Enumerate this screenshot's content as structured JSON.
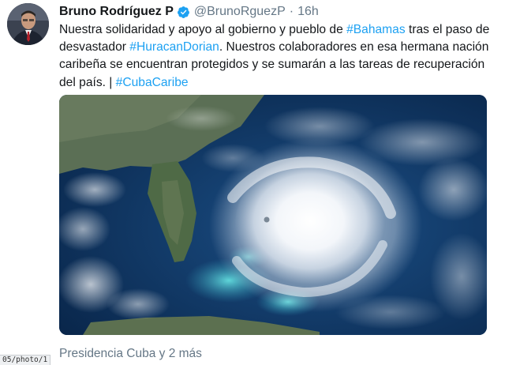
{
  "tweet": {
    "author_name": "Bruno Rodríguez P",
    "handle": "@BrunoRguezP",
    "separator": "·",
    "time": "16h",
    "text_segments": [
      {
        "text": "Nuestra solidaridad  y apoyo al gobierno y pueblo de ",
        "hashtag": false
      },
      {
        "text": "#Bahamas",
        "hashtag": true
      },
      {
        "text": " tras el paso de desvastador ",
        "hashtag": false
      },
      {
        "text": "#HuracanDorian",
        "hashtag": true
      },
      {
        "text": ". Nuestros colaboradores en esa hermana nación caribeña se encuentran protegidos y se sumarán a las tareas de recuperación del país. | ",
        "hashtag": false
      },
      {
        "text": "#CubaCaribe",
        "hashtag": true
      }
    ],
    "tagged_people": "Presidencia Cuba y 2 más"
  },
  "browser": {
    "status_url_fragment": "05/photo/1"
  },
  "icons": {
    "verified": "verified-badge-icon"
  },
  "colors": {
    "hashtag": "#1da1f2",
    "secondary_text": "#657786",
    "primary_text": "#14171a"
  }
}
